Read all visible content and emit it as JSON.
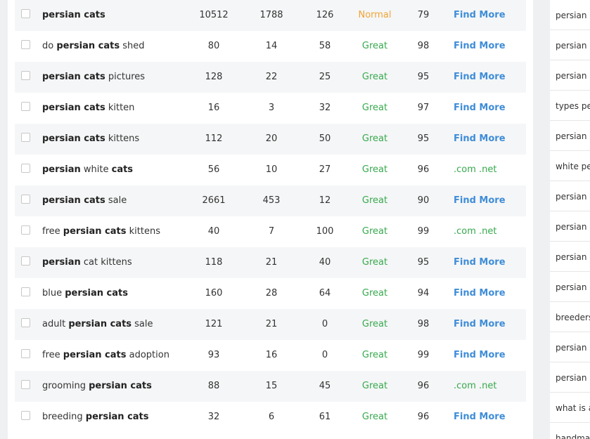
{
  "results": [
    {
      "kw": [
        {
          "t": "persian cats",
          "b": true
        }
      ],
      "search": "10512",
      "traffic": "1788",
      "qsr": "126",
      "kqi": "Normal",
      "kqi_level": "normal",
      "seo": "79",
      "action": "Find More",
      "action_type": "find"
    },
    {
      "kw": [
        {
          "t": "do ",
          "b": false
        },
        {
          "t": "persian cats",
          "b": true
        },
        {
          "t": " shed",
          "b": false
        }
      ],
      "search": "80",
      "traffic": "14",
      "qsr": "58",
      "kqi": "Great",
      "kqi_level": "great",
      "seo": "98",
      "action": "Find More",
      "action_type": "find"
    },
    {
      "kw": [
        {
          "t": "persian cats",
          "b": true
        },
        {
          "t": " pictures",
          "b": false
        }
      ],
      "search": "128",
      "traffic": "22",
      "qsr": "25",
      "kqi": "Great",
      "kqi_level": "great",
      "seo": "95",
      "action": "Find More",
      "action_type": "find"
    },
    {
      "kw": [
        {
          "t": "persian cats",
          "b": true
        },
        {
          "t": " kitten",
          "b": false
        }
      ],
      "search": "16",
      "traffic": "3",
      "qsr": "32",
      "kqi": "Great",
      "kqi_level": "great",
      "seo": "97",
      "action": "Find More",
      "action_type": "find"
    },
    {
      "kw": [
        {
          "t": "persian cats",
          "b": true
        },
        {
          "t": " kittens",
          "b": false
        }
      ],
      "search": "112",
      "traffic": "20",
      "qsr": "50",
      "kqi": "Great",
      "kqi_level": "great",
      "seo": "95",
      "action": "Find More",
      "action_type": "find"
    },
    {
      "kw": [
        {
          "t": "persian",
          "b": true
        },
        {
          "t": " white ",
          "b": false
        },
        {
          "t": "cats",
          "b": true
        }
      ],
      "search": "56",
      "traffic": "10",
      "qsr": "27",
      "kqi": "Great",
      "kqi_level": "great",
      "seo": "96",
      "action": ".com .net",
      "action_type": "domain"
    },
    {
      "kw": [
        {
          "t": "persian cats",
          "b": true
        },
        {
          "t": " sale",
          "b": false
        }
      ],
      "search": "2661",
      "traffic": "453",
      "qsr": "12",
      "kqi": "Great",
      "kqi_level": "great",
      "seo": "90",
      "action": "Find More",
      "action_type": "find"
    },
    {
      "kw": [
        {
          "t": "free ",
          "b": false
        },
        {
          "t": "persian cats",
          "b": true
        },
        {
          "t": " kittens",
          "b": false
        }
      ],
      "search": "40",
      "traffic": "7",
      "qsr": "100",
      "kqi": "Great",
      "kqi_level": "great",
      "seo": "99",
      "action": ".com .net",
      "action_type": "domain"
    },
    {
      "kw": [
        {
          "t": "persian",
          "b": true
        },
        {
          "t": " cat kittens",
          "b": false
        }
      ],
      "search": "118",
      "traffic": "21",
      "qsr": "40",
      "kqi": "Great",
      "kqi_level": "great",
      "seo": "95",
      "action": "Find More",
      "action_type": "find"
    },
    {
      "kw": [
        {
          "t": "blue ",
          "b": false
        },
        {
          "t": "persian cats",
          "b": true
        }
      ],
      "search": "160",
      "traffic": "28",
      "qsr": "64",
      "kqi": "Great",
      "kqi_level": "great",
      "seo": "94",
      "action": "Find More",
      "action_type": "find"
    },
    {
      "kw": [
        {
          "t": "adult ",
          "b": false
        },
        {
          "t": "persian cats",
          "b": true
        },
        {
          "t": " sale",
          "b": false
        }
      ],
      "search": "121",
      "traffic": "21",
      "qsr": "0",
      "kqi": "Great",
      "kqi_level": "great",
      "seo": "98",
      "action": "Find More",
      "action_type": "find"
    },
    {
      "kw": [
        {
          "t": "free ",
          "b": false
        },
        {
          "t": "persian cats",
          "b": true
        },
        {
          "t": " adoption",
          "b": false
        }
      ],
      "search": "93",
      "traffic": "16",
      "qsr": "0",
      "kqi": "Great",
      "kqi_level": "great",
      "seo": "99",
      "action": "Find More",
      "action_type": "find"
    },
    {
      "kw": [
        {
          "t": "grooming ",
          "b": false
        },
        {
          "t": "persian cats",
          "b": true
        }
      ],
      "search": "88",
      "traffic": "15",
      "qsr": "45",
      "kqi": "Great",
      "kqi_level": "great",
      "seo": "96",
      "action": ".com .net",
      "action_type": "domain"
    },
    {
      "kw": [
        {
          "t": "breeding ",
          "b": false
        },
        {
          "t": "persian cats",
          "b": true
        }
      ],
      "search": "32",
      "traffic": "6",
      "qsr": "61",
      "kqi": "Great",
      "kqi_level": "great",
      "seo": "96",
      "action": "Find More",
      "action_type": "find"
    }
  ],
  "sidebar": {
    "items": [
      "persian c",
      "persian c",
      "persian c",
      "types per",
      "persian c",
      "white pe",
      "persian c",
      "persian c",
      "persian c",
      "persian c",
      "breeders",
      "persian c",
      "persian c",
      "what is a",
      "handmad"
    ]
  },
  "colors": {
    "kqi_normal": "#f0a436",
    "kqi_great": "#37a94e",
    "link_blue": "#3f8dd8"
  }
}
